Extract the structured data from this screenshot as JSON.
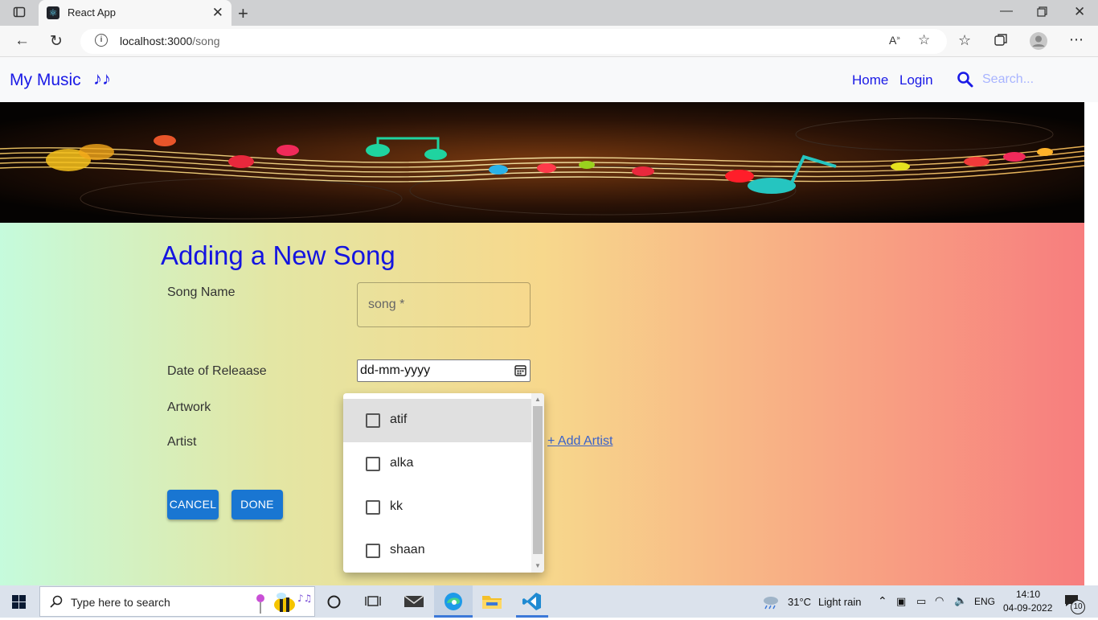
{
  "browser": {
    "tab_title": "React App",
    "url_host": "localhost:3000",
    "url_path": "/song"
  },
  "nav": {
    "brand": "My Music",
    "brand_notes": "♪♪",
    "links": [
      "Home",
      "Login"
    ],
    "search_placeholder": "Search..."
  },
  "form": {
    "title": "Adding a New Song",
    "labels": {
      "song_name": "Song Name",
      "release_date": "Date of Releaase",
      "artwork": "Artwork",
      "artist": "Artist"
    },
    "song_placeholder": "song *",
    "date_value": "dd-mm-yyyy",
    "add_artist": "+ Add Artist",
    "cancel": "CANCEL",
    "done": "DONE"
  },
  "artist_options": [
    {
      "label": "atif",
      "checked": false,
      "highlighted": true
    },
    {
      "label": "alka",
      "checked": false,
      "highlighted": false
    },
    {
      "label": "kk",
      "checked": false,
      "highlighted": false
    },
    {
      "label": "shaan",
      "checked": false,
      "highlighted": false
    }
  ],
  "taskbar": {
    "search_text": "Type here to search",
    "weather_temp": "31°C",
    "weather_desc": "Light rain",
    "lang": "ENG",
    "time": "14:10",
    "date": "04-09-2022",
    "notif_count": "10"
  },
  "colors": {
    "brand_blue": "#1a1ae6",
    "button_blue": "#1976d2"
  }
}
